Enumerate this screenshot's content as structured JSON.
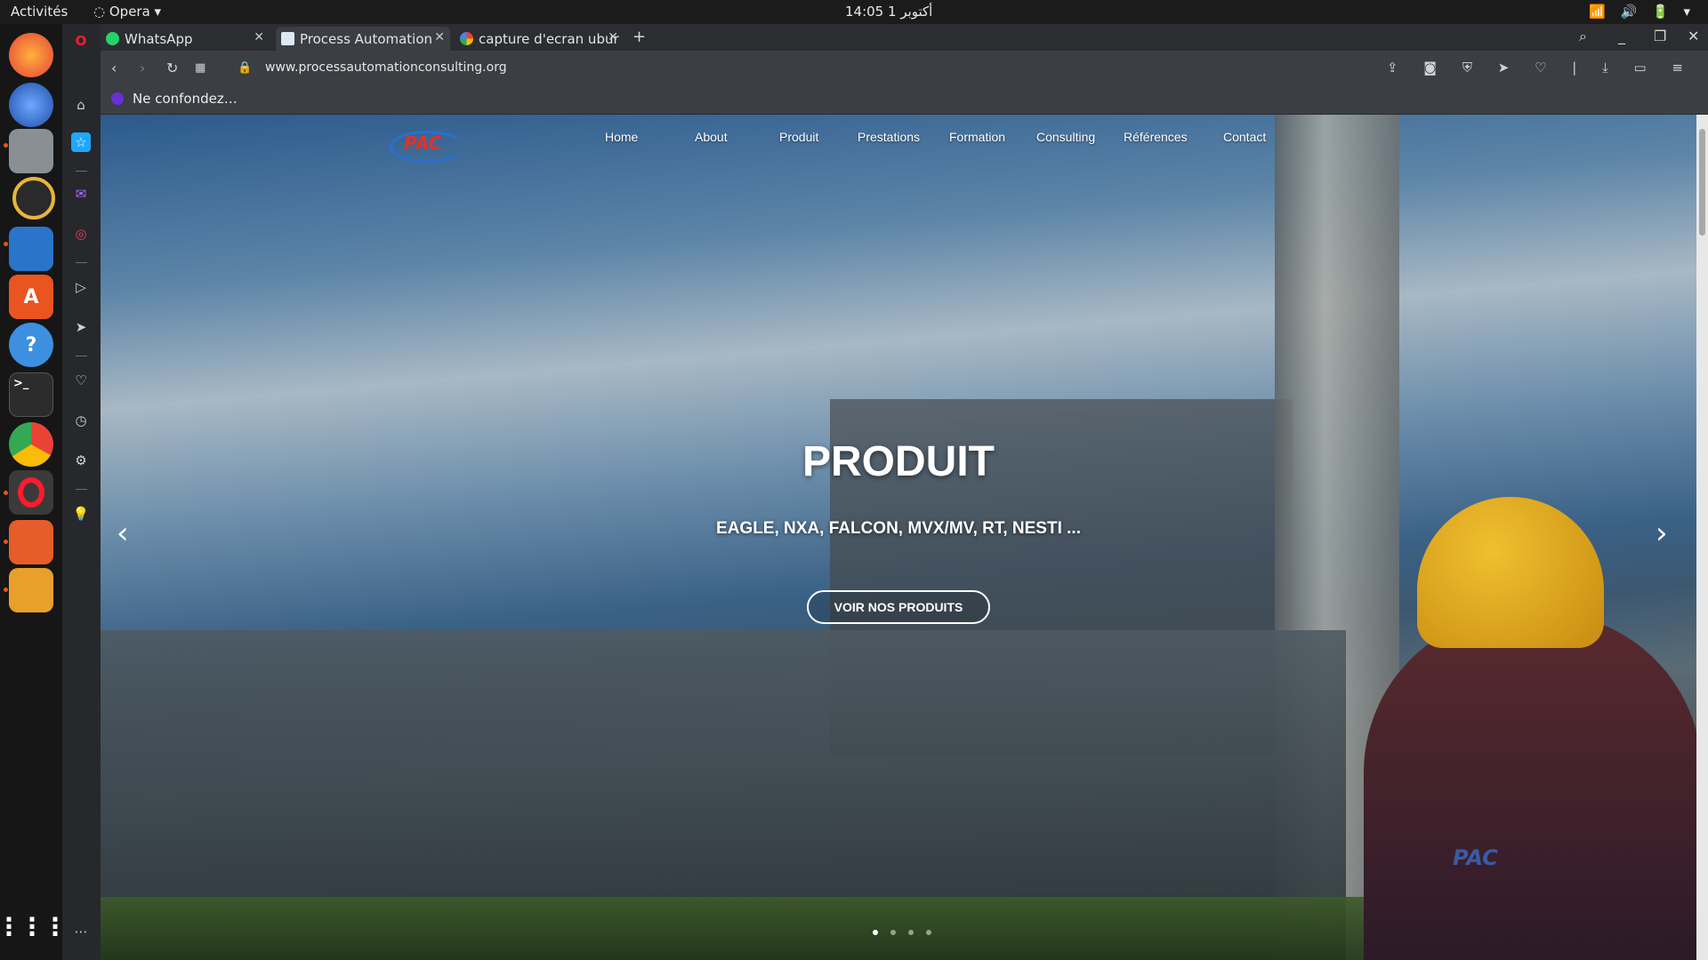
{
  "topbar": {
    "activities": "Activités",
    "app_menu": "Opera",
    "clock": "14:05  1 أكتوبر",
    "tray": "📶 🔊 🔋 ▾"
  },
  "tabs": [
    {
      "label": "WhatsApp",
      "favicon_color": "#25d366"
    },
    {
      "label": "Process Automation",
      "favicon_color": "#dfe7f5"
    },
    {
      "label": "capture d'ecran ubur",
      "favicon_color": "#4285f4"
    }
  ],
  "address_bar": {
    "url": "www.processautomationconsulting.org"
  },
  "bookmarks": [
    {
      "label": "Ne confondez…"
    }
  ],
  "site": {
    "logo_text": "PAC",
    "menu": [
      "Home",
      "About",
      "Produit",
      "Prestations",
      "Formation",
      "Consulting",
      "Références",
      "Contact"
    ],
    "hero": {
      "title": "PRODUIT",
      "subtitle": "EAGLE, NXA, FALCON, MVX/MV, RT, NESTI ...",
      "button": "VOIR NOS PRODUITS"
    },
    "slide_count": 4,
    "active_slide": 1
  }
}
